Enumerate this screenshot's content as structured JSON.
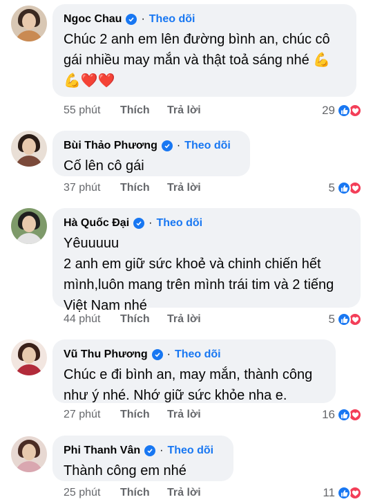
{
  "comments": [
    {
      "name": "Ngoc Chau",
      "verified": true,
      "follow_label": "Theo dõi",
      "text": "Chúc 2 anh em lên đường bình an, chúc cô gái nhiều may mắn và thật toả sáng nhé 💪 💪❤️❤️",
      "time": "55 phút",
      "like_label": "Thích",
      "reply_label": "Trả lời",
      "reaction_count": "29"
    },
    {
      "name": "Bùi Thảo Phương",
      "verified": true,
      "follow_label": "Theo dõi",
      "text": "Cố lên cô gái",
      "time": "37 phút",
      "like_label": "Thích",
      "reply_label": "Trả lời",
      "reaction_count": "5"
    },
    {
      "name": "Hà Quốc Đại",
      "verified": true,
      "follow_label": "Theo dõi",
      "text": "Yêuuuuu\n2 anh em giữ sức khoẻ và chinh chiến hết mình,luôn mang trên mình trái tim và 2 tiếng Việt Nam nhé",
      "time": "44 phút",
      "like_label": "Thích",
      "reply_label": "Trả lời",
      "reaction_count": "5"
    },
    {
      "name": "Vũ Thu Phương",
      "verified": true,
      "follow_label": "Theo dõi",
      "text": "Chúc e đi bình an, may mắn, thành công như ý nhé. Nhớ giữ sức khỏe nha e.",
      "time": "27 phút",
      "like_label": "Thích",
      "reply_label": "Trả lời",
      "reaction_count": "16"
    },
    {
      "name": "Phi Thanh Vân",
      "verified": true,
      "follow_label": "Theo dõi",
      "text": "Thành công em nhé",
      "time": "25 phút",
      "like_label": "Thích",
      "reply_label": "Trả lời",
      "reaction_count": "11"
    }
  ],
  "colors": {
    "accent": "#1877f2",
    "bubble": "#f0f2f5",
    "meta": "#65676b",
    "love": "#f33e58"
  },
  "icons": {
    "verified": "verified-badge-icon",
    "like": "like-reaction-icon",
    "love": "love-reaction-icon"
  }
}
